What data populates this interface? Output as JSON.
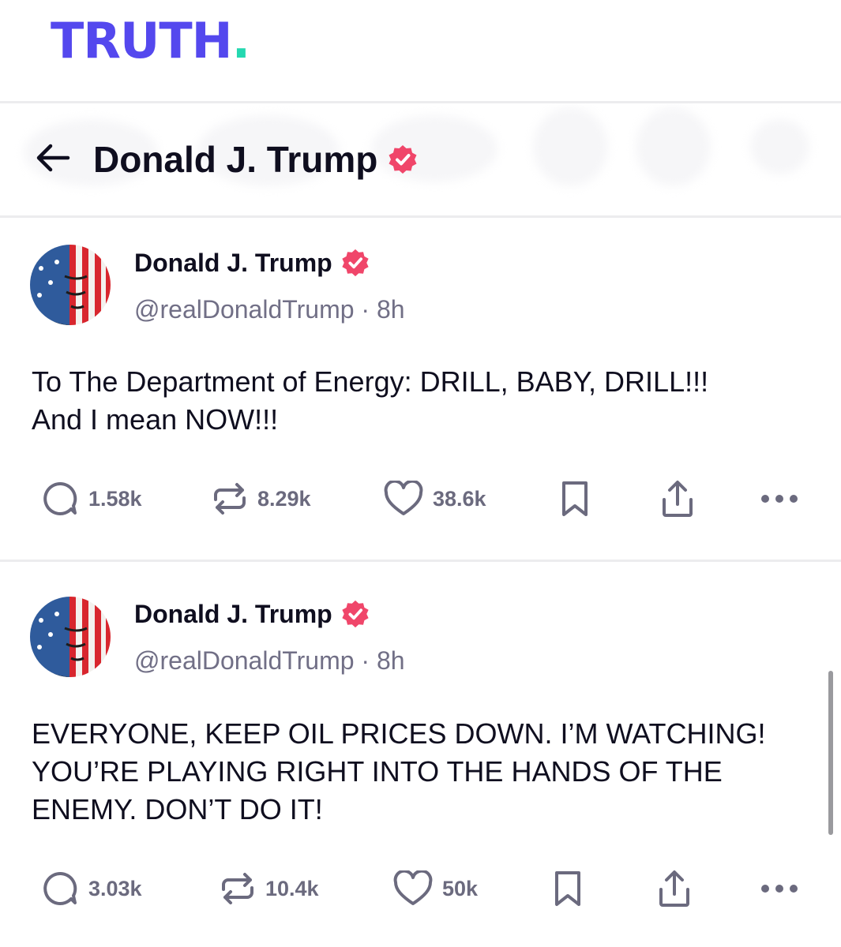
{
  "app": {
    "logo_text": "TRUTH",
    "logo_dot": ".",
    "brand_color": "#5448ee",
    "accent_color": "#24d8b0",
    "verified_color": "#f0466a"
  },
  "header": {
    "title": "Donald J. Trump",
    "back_icon": "arrow-left-icon",
    "verified_icon": "verified-badge-icon"
  },
  "posts": [
    {
      "author_name": "Donald J. Trump",
      "handle": "@realDonaldTrump",
      "separator": "·",
      "time": "8h",
      "body": [
        "To The Department of Energy: DRILL, BABY, DRILL!!!",
        "And I mean NOW!!!"
      ],
      "replies": "1.58k",
      "retruths": "8.29k",
      "likes": "38.6k"
    },
    {
      "author_name": "Donald J. Trump",
      "handle": "@realDonaldTrump",
      "separator": "·",
      "time": "8h",
      "body": [
        "EVERYONE, KEEP OIL PRICES DOWN. I’M WATCHING!",
        "YOU’RE PLAYING RIGHT INTO THE HANDS OF THE",
        "ENEMY. DON’T DO IT!"
      ],
      "replies": "3.03k",
      "retruths": "10.4k",
      "likes": "50k"
    }
  ]
}
